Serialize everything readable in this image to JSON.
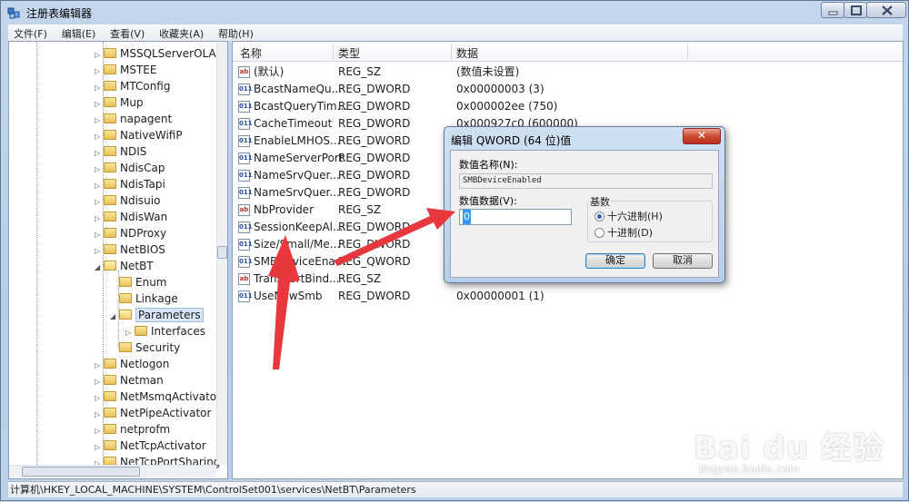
{
  "window": {
    "title": "注册表编辑器",
    "menu": [
      "文件(F)",
      "编辑(E)",
      "查看(V)",
      "收藏夹(A)",
      "帮助(H)"
    ]
  },
  "tree": {
    "items": [
      {
        "label": "MSSQLServerOLAPS",
        "expandable": true
      },
      {
        "label": "MSTEE",
        "expandable": true
      },
      {
        "label": "MTConfig",
        "expandable": true
      },
      {
        "label": "Mup",
        "expandable": true
      },
      {
        "label": "napagent",
        "expandable": true
      },
      {
        "label": "NativeWifiP",
        "expandable": true
      },
      {
        "label": "NDIS",
        "expandable": true
      },
      {
        "label": "NdisCap",
        "expandable": true
      },
      {
        "label": "NdisTapi",
        "expandable": true
      },
      {
        "label": "Ndisuio",
        "expandable": true
      },
      {
        "label": "NdisWan",
        "expandable": true
      },
      {
        "label": "NDProxy",
        "expandable": true
      },
      {
        "label": "NetBIOS",
        "expandable": true
      },
      {
        "label": "NetBT",
        "expandable": true,
        "expanded": true
      },
      {
        "label": "Enum",
        "expandable": false,
        "level": 1
      },
      {
        "label": "Linkage",
        "expandable": false,
        "level": 1
      },
      {
        "label": "Parameters",
        "expandable": true,
        "expanded": true,
        "level": 1,
        "selected": true
      },
      {
        "label": "Interfaces",
        "expandable": true,
        "level": 2
      },
      {
        "label": "Security",
        "expandable": false,
        "level": 1
      },
      {
        "label": "Netlogon",
        "expandable": true
      },
      {
        "label": "Netman",
        "expandable": true
      },
      {
        "label": "NetMsmqActivator",
        "expandable": true
      },
      {
        "label": "NetPipeActivator",
        "expandable": true
      },
      {
        "label": "netprofm",
        "expandable": true
      },
      {
        "label": "NetTcpActivator",
        "expandable": true
      },
      {
        "label": "NetTcpPortSharing",
        "expandable": true
      }
    ]
  },
  "list": {
    "columns": [
      "名称",
      "类型",
      "数据"
    ],
    "rows": [
      {
        "icon": "ab",
        "name": "(默认)",
        "type": "REG_SZ",
        "data": "(数值未设置)"
      },
      {
        "icon": "bin",
        "name": "BcastNameQu...",
        "type": "REG_DWORD",
        "data": "0x00000003 (3)"
      },
      {
        "icon": "bin",
        "name": "BcastQueryTim...",
        "type": "REG_DWORD",
        "data": "0x000002ee (750)"
      },
      {
        "icon": "bin",
        "name": "CacheTimeout",
        "type": "REG_DWORD",
        "data": "0x000927c0 (600000)"
      },
      {
        "icon": "bin",
        "name": "EnableLMHOS...",
        "type": "REG_DWORD",
        "data": ""
      },
      {
        "icon": "bin",
        "name": "NameServerPort",
        "type": "REG_DWORD",
        "data": ""
      },
      {
        "icon": "bin",
        "name": "NameSrvQuer...",
        "type": "REG_DWORD",
        "data": ""
      },
      {
        "icon": "bin",
        "name": "NameSrvQuer...",
        "type": "REG_DWORD",
        "data": ""
      },
      {
        "icon": "ab",
        "name": "NbProvider",
        "type": "REG_SZ",
        "data": ""
      },
      {
        "icon": "bin",
        "name": "SessionKeepAl...",
        "type": "REG_DWORD",
        "data": ""
      },
      {
        "icon": "bin",
        "name": "Size/Small/Me...",
        "type": "REG_DWORD",
        "data": ""
      },
      {
        "icon": "bin",
        "name": "SMBDeviceEna...",
        "type": "REG_QWORD",
        "data": ""
      },
      {
        "icon": "ab",
        "name": "TransportBind...",
        "type": "REG_SZ",
        "data": ""
      },
      {
        "icon": "bin",
        "name": "UseNewSmb",
        "type": "REG_DWORD",
        "data": "0x00000001 (1)"
      }
    ]
  },
  "status": {
    "path": "计算机\\HKEY_LOCAL_MACHINE\\SYSTEM\\ControlSet001\\services\\NetBT\\Parameters"
  },
  "dialog": {
    "title": "编辑 QWORD (64 位)值",
    "close_label": "✕",
    "name_label": "数值名称(N):",
    "name_value": "SMBDeviceEnabled",
    "data_label": "数值数据(V):",
    "data_value": "0",
    "base_label": "基数",
    "radio_hex": "十六进制(H)",
    "radio_dec": "十进制(D)",
    "selected_base": "hex",
    "ok_label": "确定",
    "cancel_label": "取消"
  },
  "watermark": {
    "brand": "Bai du 经验",
    "url": "jingyan.baidu.com"
  },
  "colors": {
    "annotation_arrow": "#e8383d",
    "selection": "#d7e5f5"
  }
}
